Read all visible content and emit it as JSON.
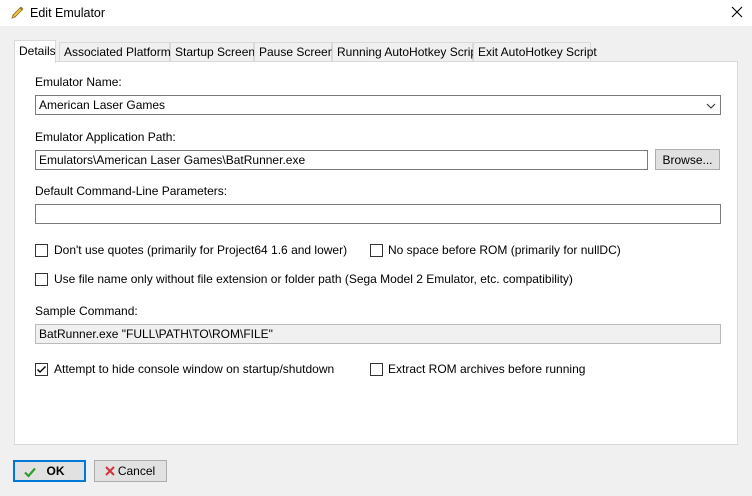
{
  "window": {
    "title": "Edit Emulator",
    "icon": "pencil-icon"
  },
  "tabs": [
    {
      "label": "Details",
      "active": true
    },
    {
      "label": "Associated Platforms",
      "active": false
    },
    {
      "label": "Startup Screen",
      "active": false
    },
    {
      "label": "Pause Screen",
      "active": false
    },
    {
      "label": "Running AutoHotkey Script",
      "active": false
    },
    {
      "label": "Exit AutoHotkey Script",
      "active": false
    }
  ],
  "details": {
    "name_label": "Emulator Name:",
    "name_value": "American Laser Games",
    "path_label": "Emulator Application Path:",
    "path_value": "Emulators\\American Laser Games\\BatRunner.exe",
    "browse_label": "Browse...",
    "params_label": "Default Command-Line Parameters:",
    "params_value": "",
    "cb_no_quotes": {
      "label": "Don't use quotes (primarily for Project64 1.6 and lower)",
      "checked": false
    },
    "cb_no_space": {
      "label": "No space before ROM (primarily for nullDC)",
      "checked": false
    },
    "cb_filename_only": {
      "label": "Use file name only without file extension or folder path (Sega Model 2 Emulator, etc. compatibility)",
      "checked": false
    },
    "sample_label": "Sample Command:",
    "sample_value": "BatRunner.exe \"FULL\\PATH\\TO\\ROM\\FILE\"",
    "cb_hide_console": {
      "label": "Attempt to hide console window on startup/shutdown",
      "checked": true
    },
    "cb_extract": {
      "label": "Extract ROM archives before running",
      "checked": false
    }
  },
  "buttons": {
    "ok_label": "OK",
    "cancel_label": "Cancel"
  },
  "colors": {
    "accent": "#0078d7",
    "ok_check": "#2e9e2e",
    "cancel_x": "#d13438"
  }
}
